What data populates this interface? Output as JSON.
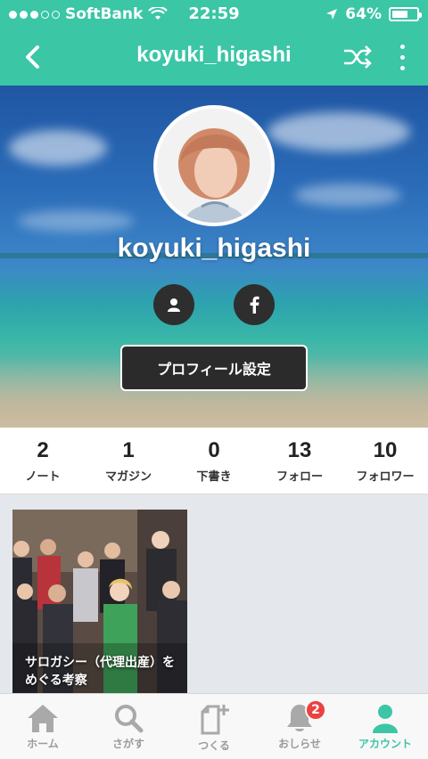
{
  "status_bar": {
    "carrier": "SoftBank",
    "time": "22:59",
    "battery": "64%",
    "battery_level": 0.64,
    "icons": [
      "signal-dots",
      "wifi-icon",
      "location-arrow-icon",
      "battery-icon"
    ]
  },
  "nav": {
    "title": "koyuki_higashi",
    "back_icon": "chevron-left-icon",
    "shuffle_icon": "shuffle-icon",
    "more_icon": "more-vertical-icon"
  },
  "profile": {
    "name": "koyuki_higashi",
    "settings_button": "プロフィール設定",
    "social_icons": [
      "person-icon",
      "facebook-icon"
    ]
  },
  "stats": [
    {
      "num": "2",
      "label": "ノート"
    },
    {
      "num": "1",
      "label": "マガジン"
    },
    {
      "num": "0",
      "label": "下書き"
    },
    {
      "num": "13",
      "label": "フォロー"
    },
    {
      "num": "10",
      "label": "フォロワー"
    }
  ],
  "cards": [
    {
      "title": "サロガシー（代理出産）をめぐる考察"
    }
  ],
  "tabs": [
    {
      "label": "ホーム",
      "icon": "home-icon",
      "active": false
    },
    {
      "label": "さがす",
      "icon": "search-icon",
      "active": false
    },
    {
      "label": "つくる",
      "icon": "create-note-icon",
      "active": false
    },
    {
      "label": "おしらせ",
      "icon": "bell-icon",
      "active": false,
      "badge": "2"
    },
    {
      "label": "アカウント",
      "icon": "account-icon",
      "active": true
    }
  ],
  "colors": {
    "accent": "#3bc6a6",
    "badge": "#ec4141",
    "tab_inactive": "#9a9a9a"
  }
}
